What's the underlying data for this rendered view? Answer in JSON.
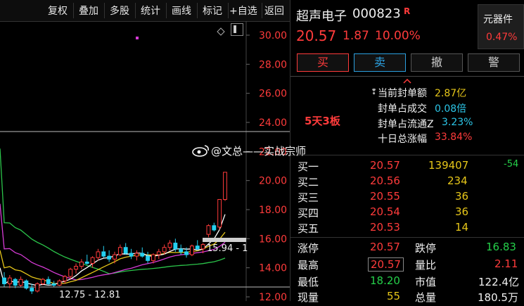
{
  "toolbar": {
    "buttons": [
      "复权",
      "叠加",
      "多股",
      "统计",
      "画线",
      "标记",
      "+自选",
      "返回"
    ]
  },
  "chart_data": {
    "type": "candlestick",
    "price_axis": {
      "labels": [
        "30.00",
        "28.00",
        "26.00",
        "24.00",
        "22.00",
        "20.00",
        "18.00",
        "16.00",
        "14.00",
        "12.00"
      ],
      "min": 12.0,
      "max": 30.0
    },
    "annotations": {
      "low_range": "12.75 - 12.81",
      "mid_label": "15.94 - 1"
    },
    "candles": [
      {
        "o": 13.3,
        "h": 13.7,
        "l": 12.7,
        "c": 12.9
      },
      {
        "o": 12.9,
        "h": 13.5,
        "l": 12.6,
        "c": 13.3
      },
      {
        "o": 13.2,
        "h": 13.3,
        "l": 12.6,
        "c": 12.8
      },
      {
        "o": 12.8,
        "h": 13.4,
        "l": 12.7,
        "c": 13.2
      },
      {
        "o": 13.1,
        "h": 13.2,
        "l": 12.5,
        "c": 12.6
      },
      {
        "o": 12.6,
        "h": 12.9,
        "l": 12.2,
        "c": 12.4
      },
      {
        "o": 12.4,
        "h": 13.0,
        "l": 12.3,
        "c": 12.9
      },
      {
        "o": 12.9,
        "h": 13.3,
        "l": 12.8,
        "c": 13.2
      },
      {
        "o": 13.2,
        "h": 13.4,
        "l": 12.8,
        "c": 12.9
      },
      {
        "o": 12.9,
        "h": 13.1,
        "l": 12.7,
        "c": 12.8
      },
      {
        "o": 12.8,
        "h": 13.2,
        "l": 12.75,
        "c": 13.1
      },
      {
        "o": 13.1,
        "h": 13.5,
        "l": 12.9,
        "c": 13.4
      },
      {
        "o": 13.4,
        "h": 14.0,
        "l": 13.2,
        "c": 13.9
      },
      {
        "o": 13.9,
        "h": 14.3,
        "l": 13.6,
        "c": 14.1
      },
      {
        "o": 14.1,
        "h": 14.6,
        "l": 13.9,
        "c": 14.4
      },
      {
        "o": 14.4,
        "h": 14.9,
        "l": 14.2,
        "c": 14.3
      },
      {
        "o": 14.3,
        "h": 14.8,
        "l": 14.0,
        "c": 14.7
      },
      {
        "o": 14.7,
        "h": 15.3,
        "l": 14.5,
        "c": 15.1
      },
      {
        "o": 15.1,
        "h": 15.5,
        "l": 14.7,
        "c": 14.8
      },
      {
        "o": 14.8,
        "h": 15.2,
        "l": 14.4,
        "c": 14.6
      },
      {
        "o": 14.6,
        "h": 15.1,
        "l": 14.3,
        "c": 14.9
      },
      {
        "o": 14.9,
        "h": 15.6,
        "l": 14.8,
        "c": 15.4
      },
      {
        "o": 15.4,
        "h": 15.7,
        "l": 14.9,
        "c": 15.0
      },
      {
        "o": 15.0,
        "h": 15.3,
        "l": 14.6,
        "c": 14.8
      },
      {
        "o": 14.8,
        "h": 15.2,
        "l": 14.5,
        "c": 15.0
      },
      {
        "o": 15.0,
        "h": 15.4,
        "l": 14.7,
        "c": 14.8
      },
      {
        "o": 14.8,
        "h": 15.1,
        "l": 14.3,
        "c": 14.5
      },
      {
        "o": 14.5,
        "h": 15.0,
        "l": 14.3,
        "c": 14.9
      },
      {
        "o": 14.9,
        "h": 15.3,
        "l": 14.6,
        "c": 15.1
      },
      {
        "o": 15.1,
        "h": 15.6,
        "l": 14.9,
        "c": 15.4
      },
      {
        "o": 15.4,
        "h": 15.9,
        "l": 15.2,
        "c": 15.7
      },
      {
        "o": 15.7,
        "h": 16.0,
        "l": 15.1,
        "c": 15.3
      },
      {
        "o": 15.3,
        "h": 15.6,
        "l": 14.9,
        "c": 15.1
      },
      {
        "o": 15.1,
        "h": 15.4,
        "l": 14.7,
        "c": 14.9
      },
      {
        "o": 14.9,
        "h": 15.6,
        "l": 14.8,
        "c": 15.5
      },
      {
        "o": 15.5,
        "h": 15.9,
        "l": 15.2,
        "c": 15.3
      },
      {
        "o": 15.3,
        "h": 15.7,
        "l": 15.0,
        "c": 15.6
      },
      {
        "o": 16.3,
        "h": 17.0,
        "l": 16.1,
        "c": 16.9
      },
      {
        "o": 16.9,
        "h": 17.1,
        "l": 16.5,
        "c": 16.6
      },
      {
        "o": 16.8,
        "h": 18.7,
        "l": 16.6,
        "c": 18.7
      },
      {
        "o": 18.7,
        "h": 20.57,
        "l": 18.6,
        "c": 20.57
      }
    ]
  },
  "stock": {
    "name": "超声电子",
    "code": "000823",
    "badge": "R",
    "price": "20.57",
    "change": "1.87",
    "change_pct": "10.00%",
    "sector_name": "元器件",
    "sector_pct": "0.47%"
  },
  "actions": {
    "buy": "买",
    "sell": "卖",
    "cancel": "撤",
    "alert": "警"
  },
  "seal_info": {
    "board_label": "5天3板",
    "rows": [
      {
        "label": "当前封单额",
        "value": "2.87亿"
      },
      {
        "label": "封单占成交",
        "value": "0.08倍"
      },
      {
        "label": "封单占流通Z",
        "value": "3.23%"
      },
      {
        "label": "十日总涨幅",
        "value": "33.84%"
      }
    ]
  },
  "watermark": "@文总——实战宗师",
  "order_book": [
    {
      "label": "买一",
      "price": "20.57",
      "vol": "139407",
      "delta": "-54"
    },
    {
      "label": "买二",
      "price": "20.56",
      "vol": "234",
      "delta": ""
    },
    {
      "label": "买三",
      "price": "20.55",
      "vol": "36",
      "delta": ""
    },
    {
      "label": "买四",
      "price": "20.54",
      "vol": "36",
      "delta": ""
    },
    {
      "label": "买五",
      "price": "20.53",
      "vol": "14",
      "delta": ""
    }
  ],
  "stats": [
    {
      "l1": "涨停",
      "v1": "20.57",
      "l2": "跌停",
      "v2": "16.83"
    },
    {
      "l1": "最高",
      "v1": "20.57",
      "l2": "量比",
      "v2": "2.11"
    },
    {
      "l1": "最低",
      "v1": "18.20",
      "l2": "市值",
      "v2": "122.4亿"
    },
    {
      "l1": "现量",
      "v1": "55",
      "l2": "总量",
      "v2": "180.5万"
    }
  ],
  "colors": {
    "up": "#ff3b3b",
    "down": "#25d0f0",
    "ma5": "#ffffff",
    "ma10": "#e6c619",
    "ma20": "#d63bd6",
    "ma60": "#2bc44a"
  }
}
